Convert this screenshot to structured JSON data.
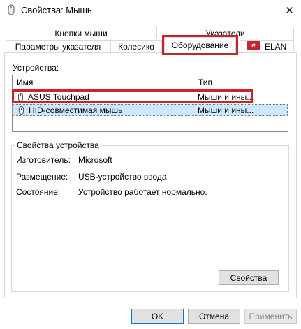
{
  "window": {
    "title": "Свойства: Мышь",
    "close_glyph": "✕"
  },
  "tabs": {
    "row1": [
      "Кнопки мыши",
      "Указатели"
    ],
    "row2": [
      "Параметры указателя",
      "Колесико",
      "Оборудование",
      "ELAN"
    ],
    "active": "Оборудование"
  },
  "devices": {
    "label": "Устройства:",
    "columns": [
      "Имя",
      "Тип"
    ],
    "rows": [
      {
        "name": "ASUS Touchpad",
        "type": "Мыши и ины..."
      },
      {
        "name": "HID-совместимая мышь",
        "type": "Мыши и ины..."
      }
    ],
    "selected_row": 1
  },
  "device_properties": {
    "title": "Свойства устройства",
    "manufacturer_label": "Изготовитель:",
    "manufacturer_value": "Microsoft",
    "location_label": "Размещение:",
    "location_value": "USB-устройство ввода",
    "status_label": "Состояние:",
    "status_value": "Устройство работает нормально.",
    "properties_button": "Свойства"
  },
  "buttons": {
    "ok": "OK",
    "cancel": "Отмена",
    "apply": "Применить"
  },
  "colors": {
    "highlight": "#c8242c",
    "selection": "#cce8ff",
    "accent": "#0078d7"
  }
}
